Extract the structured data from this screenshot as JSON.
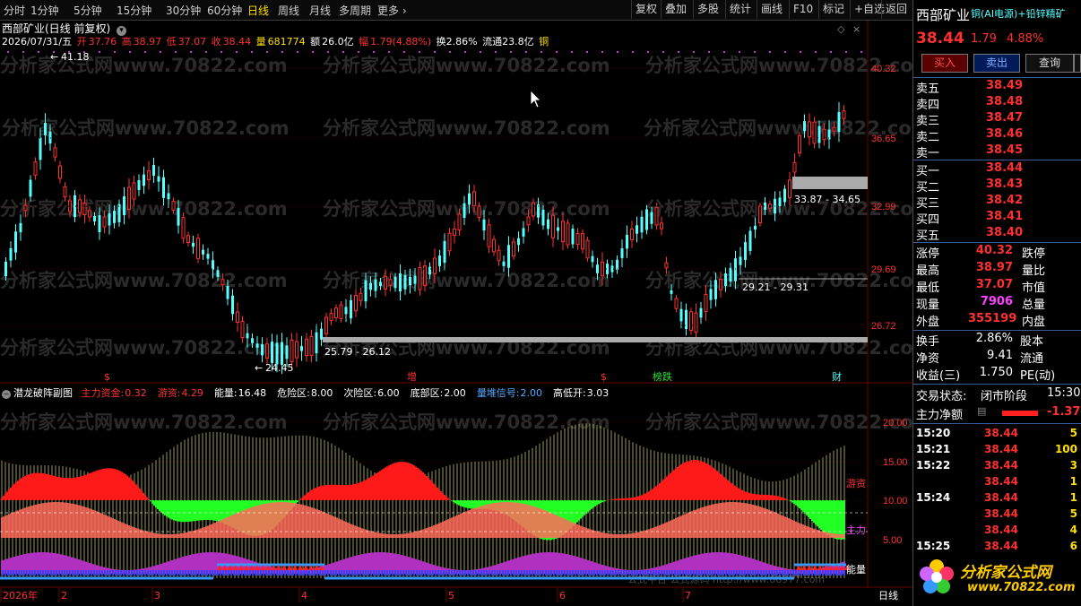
{
  "toolbar": {
    "periods": [
      "分时",
      "1分钟",
      "5分钟",
      "15分钟",
      "30分钟",
      "60分钟",
      "日线",
      "周线",
      "月线",
      "多周期",
      "更多"
    ],
    "active_period": "日线",
    "right_buttons": [
      "复权",
      "叠加",
      "多股",
      "统计",
      "画线",
      "F10",
      "标记",
      "+自选",
      "返回"
    ]
  },
  "chart_header": {
    "title": "西部矿业(日线 前复权)",
    "date": "2026/07/31/五",
    "open_label": "开",
    "open": "37.76",
    "high_label": "高",
    "high": "38.97",
    "low_label": "低",
    "low": "37.07",
    "close_label": "收",
    "close": "38.44",
    "vol_label": "量",
    "vol": "681774",
    "amount_label": "额",
    "amount": "26.0亿",
    "range_label": "幅",
    "range": "1.79(4.88%)",
    "turnover": "换2.86%",
    "float": "流通23.8亿",
    "extra": "铜"
  },
  "price_axis": [
    "40.32",
    "36.65",
    "32.99",
    "29.69",
    "26.72"
  ],
  "price_annotations": {
    "high": "41.18",
    "low": "24.45",
    "zone1": "33.87 - 34.65",
    "zone2": "29.21 - 29.31",
    "zone3": "25.79 - 26.12"
  },
  "event_markers": [
    "$",
    "增",
    "$",
    "榜跌",
    "财"
  ],
  "indicator": {
    "name": "潜龙破阵副图",
    "params": [
      {
        "label": "主力资金:",
        "value": "0.32",
        "color": "#ff3030"
      },
      {
        "label": "游资:",
        "value": "4.29",
        "color": "#ff3030"
      },
      {
        "label": "能量:",
        "value": "16.48",
        "color": "#ffffff"
      },
      {
        "label": "危险区:",
        "value": "8.00",
        "color": "#ffffff"
      },
      {
        "label": "次险区:",
        "value": "6.00",
        "color": "#ffffff"
      },
      {
        "label": "底部区:",
        "value": "2.00",
        "color": "#ffffff"
      },
      {
        "label": "量堆信号:",
        "value": "2.00",
        "color": "#54aaff"
      },
      {
        "label": "高低开:",
        "value": "3.03",
        "color": "#ffffff"
      }
    ],
    "axis": [
      "20.00",
      "15.00",
      "10.00",
      "5.00"
    ],
    "side_labels": [
      "游资",
      "主力",
      "能量"
    ]
  },
  "time_axis": [
    "2026年",
    "2",
    "3",
    "4",
    "5",
    "6",
    "7"
  ],
  "time_axis_right": "日线",
  "watermark_main": "分析家公式网www.70822.com",
  "watermark_bottom": "公式平台 公式源码 http://www.66977.com",
  "right_panel": {
    "name": "西部矿业",
    "tags": "铜(AI电源)+铅锌精矿",
    "price": "38.44",
    "change": "1.79",
    "pct": "4.88%",
    "buttons": [
      "买入",
      "卖出",
      "查询"
    ],
    "asks": [
      {
        "label": "卖五",
        "price": "38.49"
      },
      {
        "label": "卖四",
        "price": "38.48"
      },
      {
        "label": "卖三",
        "price": "38.47"
      },
      {
        "label": "卖二",
        "price": "38.46"
      },
      {
        "label": "卖一",
        "price": "38.45"
      }
    ],
    "bids": [
      {
        "label": "买一",
        "price": "38.44"
      },
      {
        "label": "买二",
        "price": "38.43"
      },
      {
        "label": "买三",
        "price": "38.42"
      },
      {
        "label": "买四",
        "price": "38.41"
      },
      {
        "label": "买五",
        "price": "38.40"
      }
    ],
    "stats1": [
      {
        "l1": "涨停",
        "v1": "40.32",
        "l2": "跌停",
        "v2": ""
      },
      {
        "l1": "最高",
        "v1": "38.97",
        "l2": "量比",
        "v2": ""
      },
      {
        "l1": "最低",
        "v1": "37.07",
        "l2": "市值",
        "v2": ""
      },
      {
        "l1": "现量",
        "v1": "7906",
        "l2": "总量",
        "v2": ""
      },
      {
        "l1": "外盘",
        "v1": "355199",
        "l2": "内盘",
        "v2": ""
      }
    ],
    "stats2": [
      {
        "l1": "换手",
        "v1": "2.86%",
        "l2": "股本"
      },
      {
        "l1": "净资",
        "v1": "9.41",
        "l2": "流通"
      },
      {
        "l1": "收益(三)",
        "v1": "1.750",
        "l2": "PE(动)"
      }
    ],
    "status_label": "交易状态:",
    "status_value": "闭市阶段",
    "status_time": "15:30",
    "net_label": "主力净额",
    "net_value": "-1.37",
    "ticks": [
      {
        "time": "15:20",
        "price": "38.44",
        "vol": "5"
      },
      {
        "time": "15:21",
        "price": "38.44",
        "vol": "100"
      },
      {
        "time": "15:22",
        "price": "38.44",
        "vol": "3"
      },
      {
        "time": "",
        "price": "38.44",
        "vol": "1"
      },
      {
        "time": "15:24",
        "price": "38.44",
        "vol": "1"
      },
      {
        "time": "",
        "price": "38.44",
        "vol": "5"
      },
      {
        "time": "",
        "price": "38.44",
        "vol": "4"
      },
      {
        "time": "15:25",
        "price": "38.44",
        "vol": "6"
      }
    ],
    "logo_text": "分析家公式网",
    "logo_url": "www.70822.com"
  }
}
